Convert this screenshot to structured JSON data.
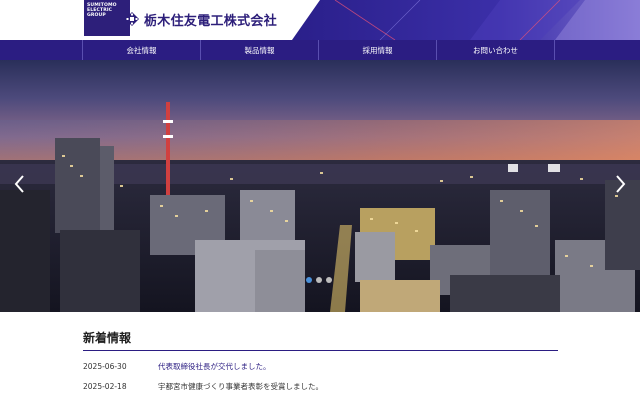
{
  "brand": {
    "badge_lines": [
      "SUMITOMO",
      "ELECTRIC",
      "GROUP"
    ],
    "company_name": "栃木住友電工株式会社",
    "primary_color": "#2b1d82"
  },
  "nav": {
    "items": [
      {
        "label": "会社情報"
      },
      {
        "label": "製品情報"
      },
      {
        "label": "採用情報"
      },
      {
        "label": "お問い合わせ"
      }
    ]
  },
  "hero": {
    "slide_count": 3,
    "active_slide": 1,
    "prev_icon": "chevron-left-icon",
    "next_icon": "chevron-right-icon"
  },
  "news": {
    "title": "新着情報",
    "items": [
      {
        "date": "2025-06-30",
        "text": "代表取締役社長が交代しました。",
        "is_link": true
      },
      {
        "date": "2025-02-18",
        "text": "宇都宮市健康づくり事業者表彰を受賞しました。",
        "is_link": false
      }
    ]
  }
}
